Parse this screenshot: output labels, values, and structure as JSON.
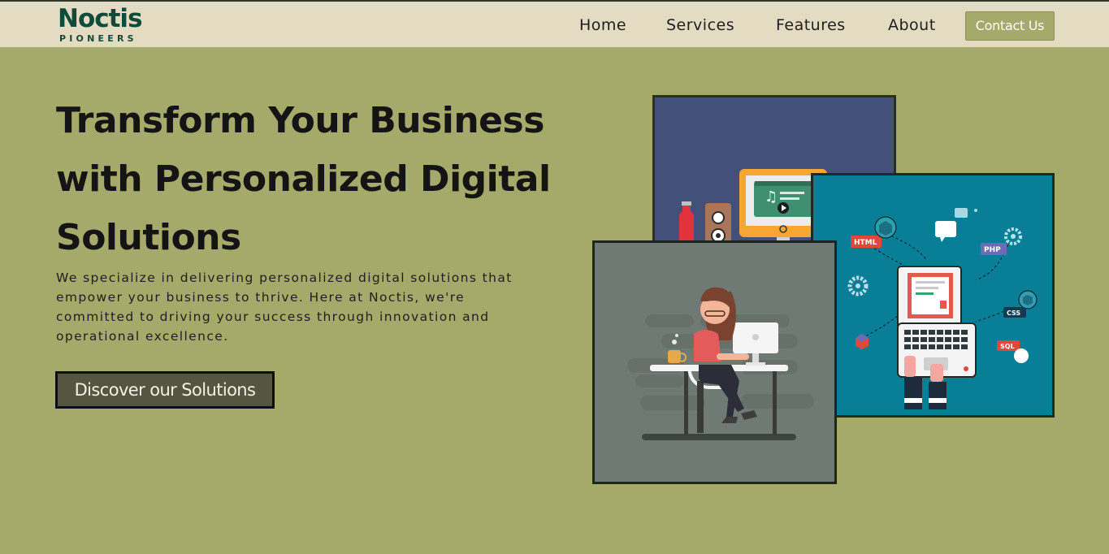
{
  "header": {
    "logo_word": "Noctis",
    "logo_sub": "PIONEERS",
    "nav": [
      "Home",
      "Services",
      "Features",
      "About"
    ],
    "contact_label": "Contact Us"
  },
  "hero": {
    "title_line1": "Transform Your Business",
    "title_line2": "with Personalized Digital",
    "title_line3": "Solutions",
    "description": "We specialize in delivering personalized digital solutions that empower your business to thrive. Here at Noctis, we're committed to driving your success through innovation and operational excellence.",
    "cta_label": "Discover our Solutions"
  },
  "illustrations": {
    "dev_labels": [
      "HTML",
      "PHP",
      "CSS",
      "SQL"
    ]
  },
  "colors": {
    "background": "#a5a96a",
    "navbar": "#e3dcc2",
    "brand": "#0f4a3a",
    "button": "#555641",
    "card_blue": "#42507a",
    "card_teal": "#087f97",
    "card_gray": "#6f7a74"
  },
  "icons": [
    "compass-icon",
    "music-note-icon",
    "play-icon",
    "soda-bottle-icon",
    "speaker-icon",
    "gear-icon",
    "chat-bubble-icon",
    "cube-icon",
    "laptop-icon",
    "monitor-icon"
  ]
}
